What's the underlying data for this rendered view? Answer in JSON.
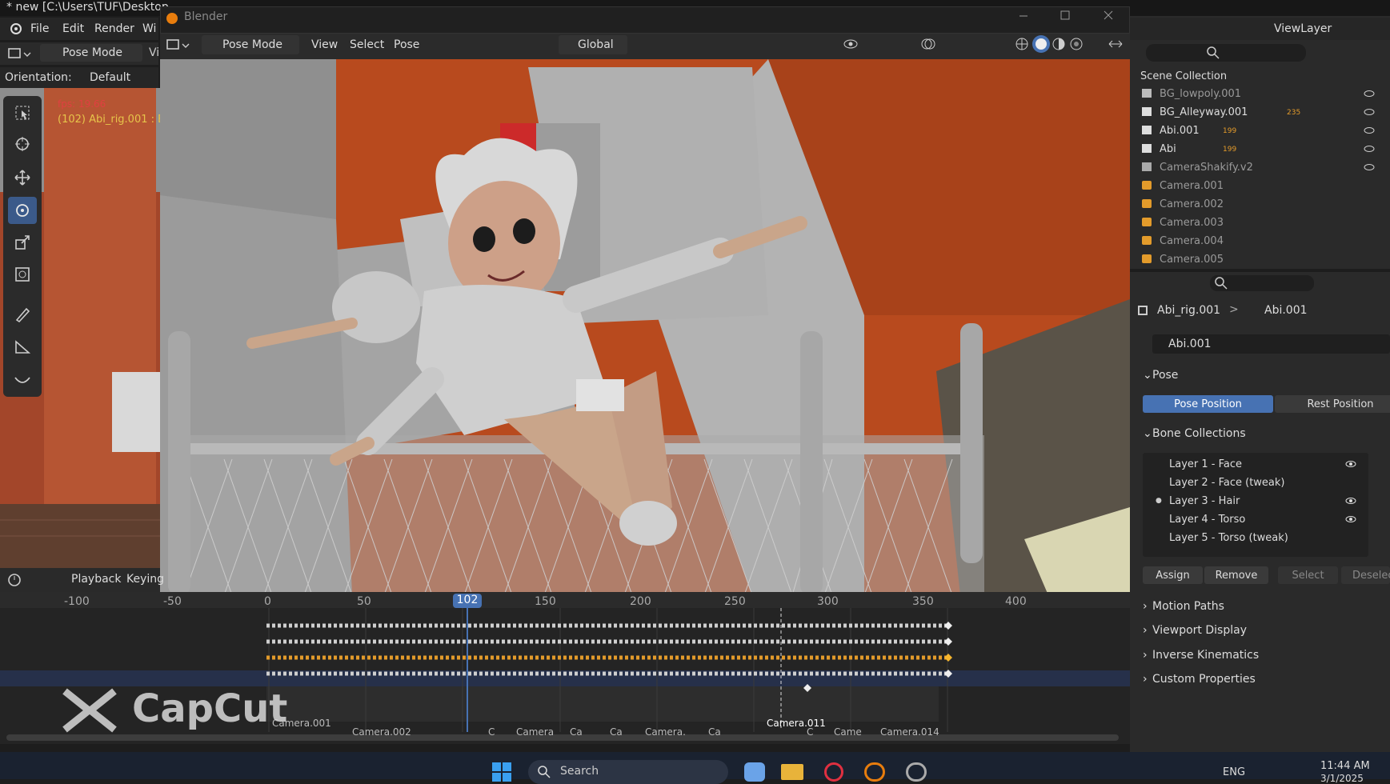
{
  "window": {
    "title": "* new [C:\\Users\\TUF\\Desktop",
    "float_title": "Blender"
  },
  "menu": [
    "File",
    "Edit",
    "Render",
    "Wi"
  ],
  "left_header": {
    "mode": "Pose Mode",
    "extra": "Vi"
  },
  "orientation": {
    "label": "Orientation:",
    "value": "Default"
  },
  "overlay": {
    "fps": "fps: 19.66",
    "object": "(102) Abi_rig.001 : B"
  },
  "viewport_header": {
    "mode": "Pose Mode",
    "menus": [
      "View",
      "Select",
      "Pose"
    ],
    "transform": "Global"
  },
  "timeline": {
    "header": [
      "Playback",
      "Keying"
    ],
    "ticks": [
      "-100",
      "-50",
      "0",
      "50",
      "102",
      "150",
      "200",
      "250",
      "300",
      "350",
      "400"
    ],
    "current_frame": "102",
    "camera_markers": [
      "Camera.001",
      "Camera.002",
      "C",
      "Camera",
      "Ca",
      "Ca",
      "Camera.",
      "Ca",
      "C",
      "Came",
      "Camera.014"
    ],
    "marker_label": "Camera.011"
  },
  "outliner": {
    "view_layer": "ViewLayer",
    "scene": "Scene Collection",
    "items": [
      {
        "name": "BG_lowpoly.001",
        "dim": true
      },
      {
        "name": "BG_Alleyway.001",
        "dim": false,
        "count": "235"
      },
      {
        "name": "Abi.001",
        "dim": false,
        "count": "199"
      },
      {
        "name": "Abi",
        "dim": false,
        "count": "199"
      },
      {
        "name": "CameraShakify.v2",
        "dim": true
      },
      {
        "name": "Camera.001",
        "dim": true
      },
      {
        "name": "Camera.002",
        "dim": true
      },
      {
        "name": "Camera.003",
        "dim": true
      },
      {
        "name": "Camera.004",
        "dim": true
      },
      {
        "name": "Camera.005",
        "dim": true
      }
    ]
  },
  "properties": {
    "breadcrumb": [
      "Abi_rig.001",
      "Abi.001"
    ],
    "armature": "Abi.001",
    "pose_section": "Pose",
    "pose_position": "Pose Position",
    "rest_position": "Rest Position",
    "bone_collections": "Bone Collections",
    "layers": [
      "Layer 1 - Face",
      "Layer 2 - Face (tweak)",
      "Layer 3 - Hair",
      "Layer 4 - Torso",
      "Layer 5 - Torso (tweak)"
    ],
    "buttons": [
      "Assign",
      "Remove",
      "Select",
      "Deselec"
    ],
    "panels": [
      "Motion Paths",
      "Viewport Display",
      "Inverse Kinematics",
      "Custom Properties"
    ]
  },
  "watermark": "CapCut",
  "taskbar": {
    "search": "Search",
    "lang": "ENG",
    "time": "11:44 AM",
    "date": "3/1/2025"
  },
  "colors": {
    "accent": "#4772b3",
    "orange": "#e39b2b",
    "wall": "#b84a1e"
  }
}
